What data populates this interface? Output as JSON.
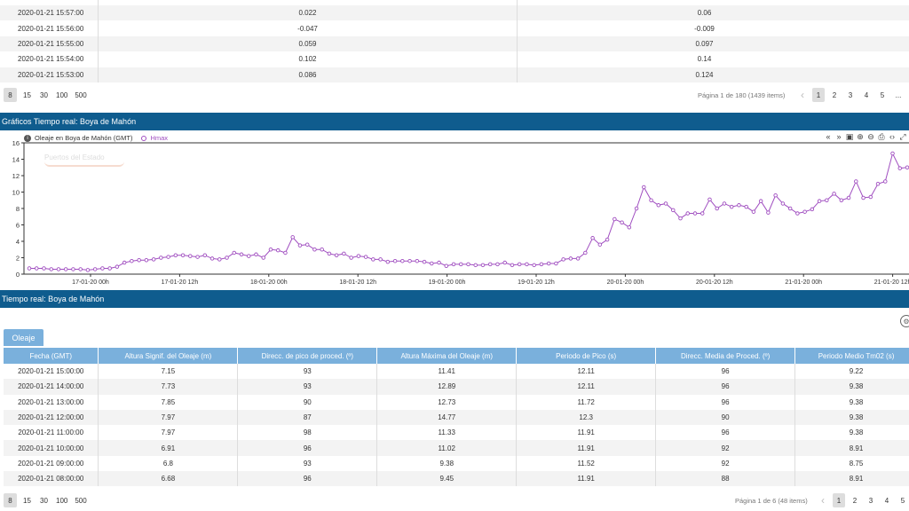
{
  "top_table": {
    "rows": [
      [
        "2020-01-21 15:57:00",
        "0.022",
        "0.06"
      ],
      [
        "2020-01-21 15:56:00",
        "-0.047",
        "-0.009"
      ],
      [
        "2020-01-21 15:55:00",
        "0.059",
        "0.097"
      ],
      [
        "2020-01-21 15:54:00",
        "0.102",
        "0.14"
      ],
      [
        "2020-01-21 15:53:00",
        "0.086",
        "0.124"
      ]
    ],
    "page_sizes": [
      "8",
      "15",
      "30",
      "100",
      "500"
    ],
    "selected_size": "8",
    "pager_info": "Página 1 de 180 (1439 items)",
    "pages": [
      "1",
      "2",
      "3",
      "4",
      "5",
      "..."
    ],
    "current_page": "1"
  },
  "chart_section": {
    "title": "Gráficos Tiempo real: Boya de Mahón"
  },
  "chart": {
    "header_title": "Oleaje en Boya de Mahón (GMT)",
    "legend_label": "Hmax",
    "watermark": "Puertos del Estado",
    "series_color": "#a04ec0",
    "tool_icons": [
      "double-left-icon",
      "double-right-icon",
      "calendar-icon",
      "zoom-in-icon",
      "zoom-out-icon",
      "print-icon",
      "code-icon",
      "fullscreen-icon"
    ]
  },
  "chart_data": {
    "type": "line",
    "title": "Oleaje en Boya de Mahón (GMT)",
    "xlabel": "",
    "ylabel": "",
    "ylim": [
      0,
      16
    ],
    "yticks": [
      0,
      2,
      4,
      6,
      8,
      10,
      12,
      14,
      16
    ],
    "xticks": [
      "17-01-20 00h",
      "17-01-20 12h",
      "18-01-20 00h",
      "18-01-20 12h",
      "19-01-20 00h",
      "19-01-20 12h",
      "20-01-20 00h",
      "20-01-20 12h",
      "21-01-20 00h",
      "21-01-20 12h"
    ],
    "grid": false,
    "legend": "top-left",
    "series": [
      {
        "name": "Hmax",
        "values": [
          0.7,
          0.7,
          0.7,
          0.6,
          0.6,
          0.6,
          0.6,
          0.6,
          0.5,
          0.6,
          0.7,
          0.7,
          0.9,
          1.4,
          1.6,
          1.7,
          1.7,
          1.8,
          2.0,
          2.1,
          2.3,
          2.3,
          2.2,
          2.1,
          2.3,
          1.9,
          1.8,
          2.0,
          2.6,
          2.4,
          2.2,
          2.4,
          2.0,
          3.0,
          2.9,
          2.6,
          4.5,
          3.5,
          3.6,
          3.0,
          3.0,
          2.5,
          2.3,
          2.5,
          2.0,
          2.2,
          2.1,
          1.8,
          1.8,
          1.5,
          1.6,
          1.6,
          1.6,
          1.6,
          1.5,
          1.3,
          1.4,
          1.0,
          1.2,
          1.2,
          1.2,
          1.1,
          1.1,
          1.2,
          1.2,
          1.4,
          1.1,
          1.2,
          1.2,
          1.1,
          1.2,
          1.3,
          1.3,
          1.8,
          1.9,
          1.9,
          2.6,
          4.4,
          3.6,
          4.2,
          6.7,
          6.3,
          5.7,
          8.0,
          10.6,
          9.0,
          8.4,
          8.6,
          7.8,
          6.8,
          7.4,
          7.4,
          7.4,
          9.1,
          8.0,
          8.6,
          8.2,
          8.4,
          8.2,
          7.6,
          8.9,
          7.5,
          9.6,
          8.6,
          8.0,
          7.4,
          7.6,
          7.9,
          8.9,
          9.0,
          9.8,
          9.0,
          9.3,
          11.3,
          9.3,
          9.4,
          11.0,
          11.3,
          14.7,
          12.9,
          13.0
        ]
      }
    ]
  },
  "table_section": {
    "title": "Tiempo real: Boya de Mahón"
  },
  "tab_label": "Oleaje",
  "data_table": {
    "headers": [
      "Fecha (GMT)",
      "Altura Signif. del Oleaje (m)",
      "Direcc. de pico de proced. (º)",
      "Altura Máxima del Oleaje (m)",
      "Periodo de Pico (s)",
      "Direcc. Media de Proced. (º)",
      "Periodo Medio Tm02 (s)"
    ],
    "rows": [
      [
        "2020-01-21 15:00:00",
        "7.15",
        "93",
        "11.41",
        "12.11",
        "96",
        "9.22"
      ],
      [
        "2020-01-21 14:00:00",
        "7.73",
        "93",
        "12.89",
        "12.11",
        "96",
        "9.38"
      ],
      [
        "2020-01-21 13:00:00",
        "7.85",
        "90",
        "12.73",
        "11.72",
        "96",
        "9.38"
      ],
      [
        "2020-01-21 12:00:00",
        "7.97",
        "87",
        "14.77",
        "12.3",
        "90",
        "9.38"
      ],
      [
        "2020-01-21 11:00:00",
        "7.97",
        "98",
        "11.33",
        "11.91",
        "96",
        "9.38"
      ],
      [
        "2020-01-21 10:00:00",
        "6.91",
        "96",
        "11.02",
        "11.91",
        "92",
        "8.91"
      ],
      [
        "2020-01-21 09:00:00",
        "6.8",
        "93",
        "9.38",
        "11.52",
        "92",
        "8.75"
      ],
      [
        "2020-01-21 08:00:00",
        "6.68",
        "96",
        "9.45",
        "11.91",
        "88",
        "8.91"
      ]
    ]
  },
  "bottom_pager": {
    "page_sizes": [
      "8",
      "15",
      "30",
      "100",
      "500"
    ],
    "selected_size": "8",
    "pager_info": "Página 1 de 6 (48 items)",
    "pages": [
      "1",
      "2",
      "3",
      "4",
      "5"
    ],
    "current_page": "1"
  }
}
